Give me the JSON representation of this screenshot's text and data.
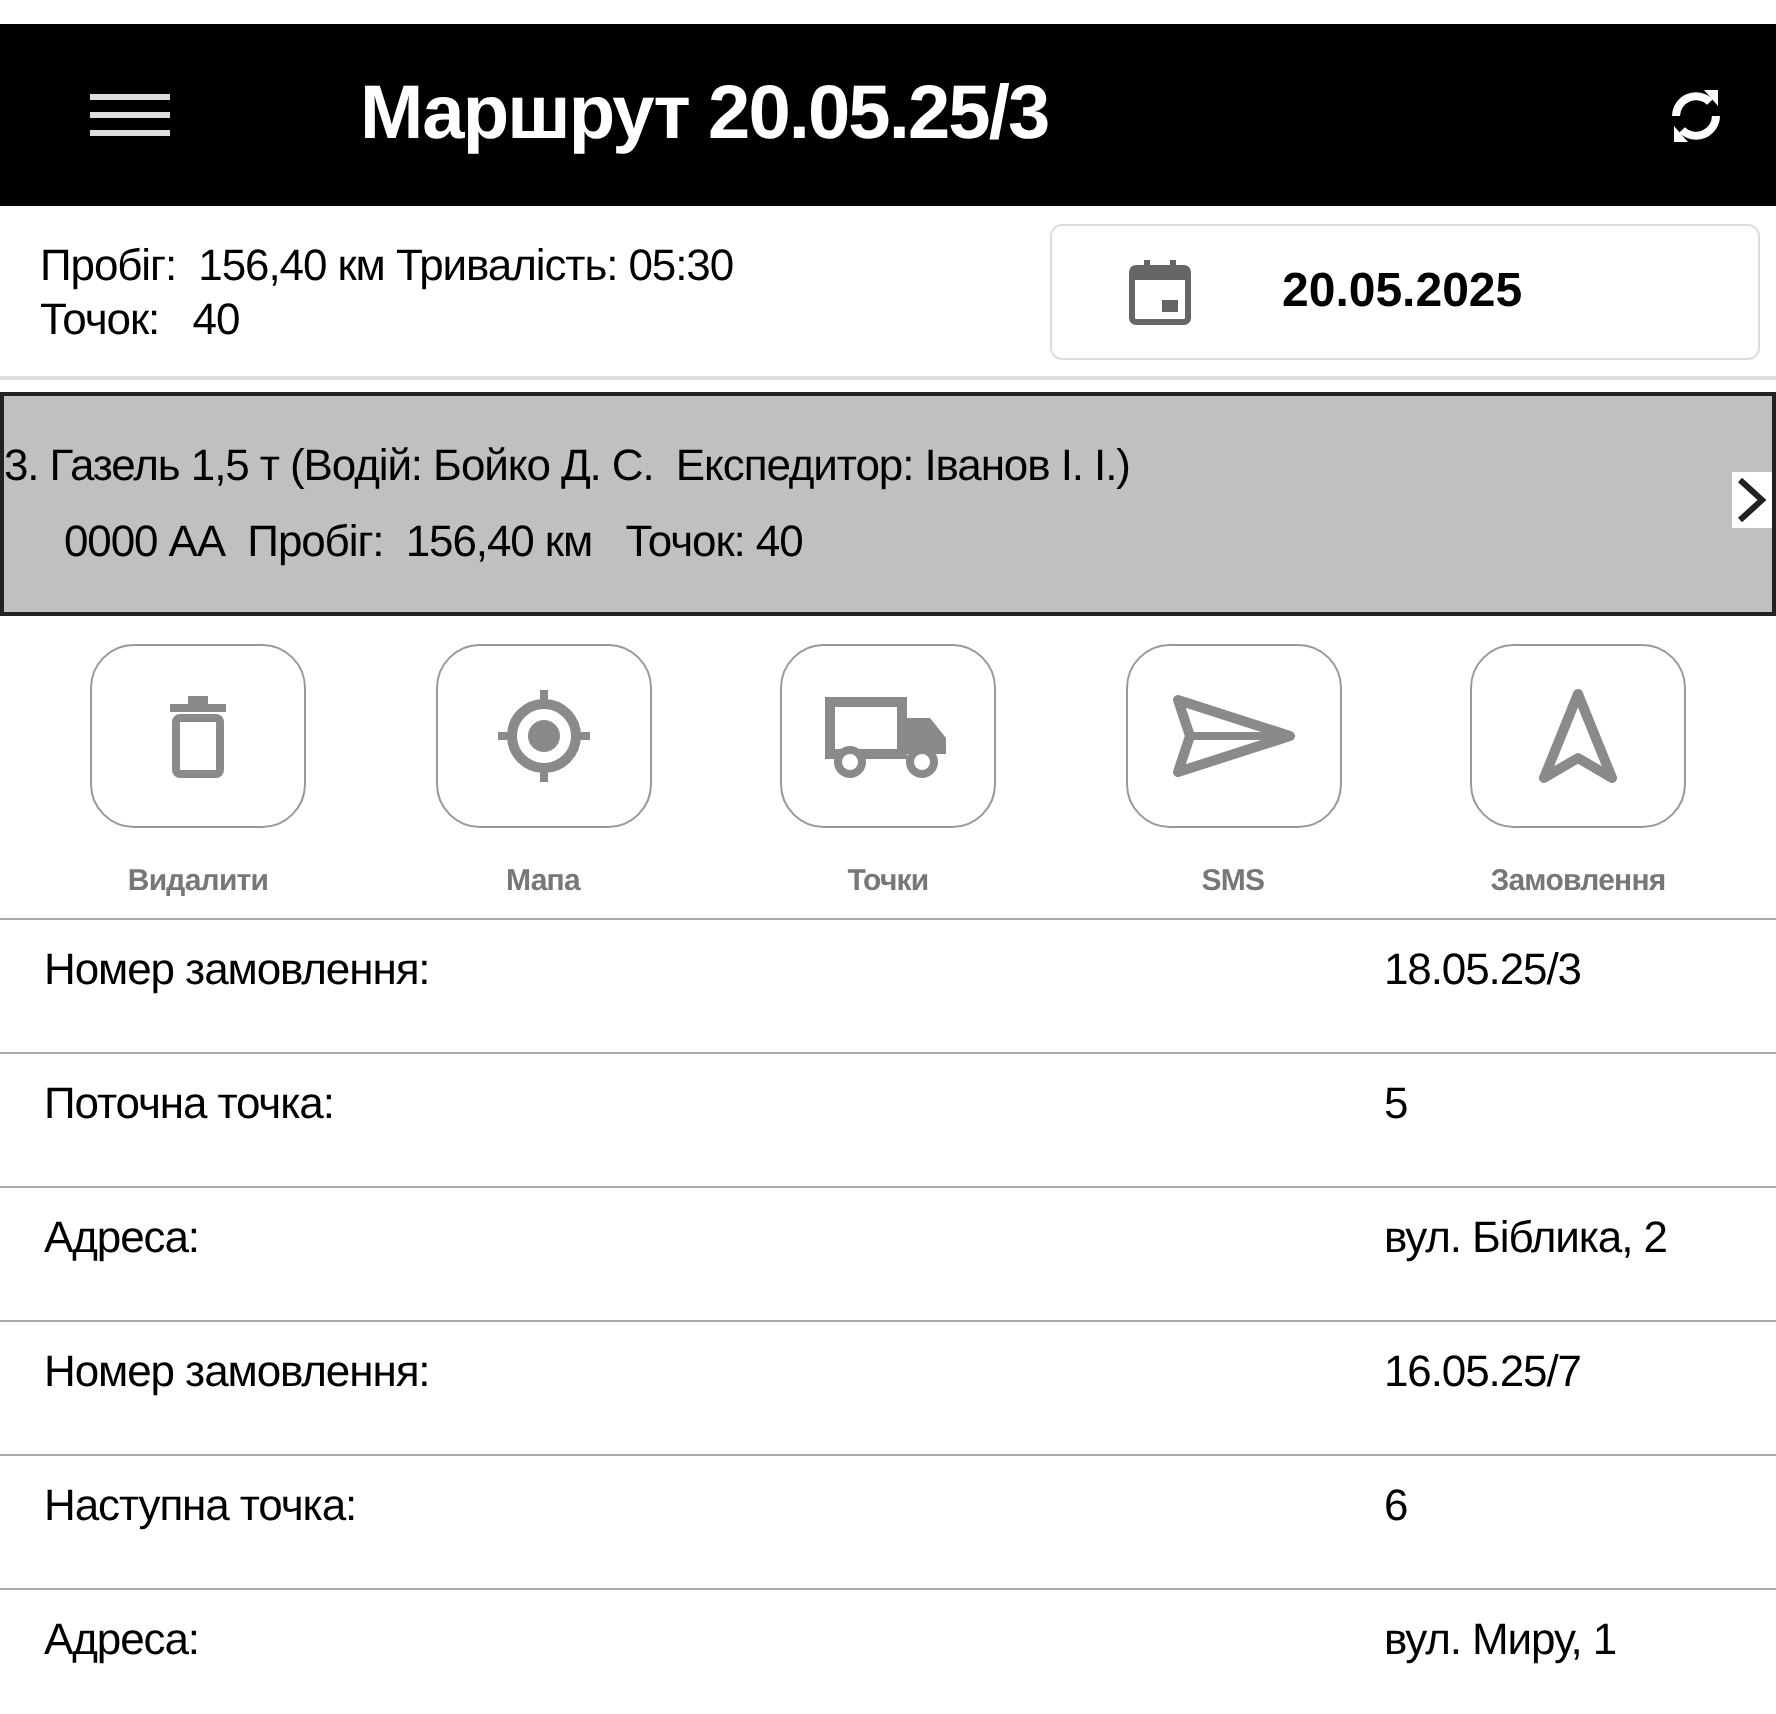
{
  "header": {
    "title": "Маршрут 20.05.25/3"
  },
  "summary": {
    "line_1": "Пробіг:  156,40 км Тривалість: 05:30",
    "line_2": "Точок:   40"
  },
  "date_button": {
    "label": "20.05.2025"
  },
  "vehicle": {
    "line_1": "3. Газель 1,5 т (Водій: Бойко Д. С.  Експедитор: Іванов І. І.)",
    "line_2": "0000 АА  Пробіг:  156,40 км   Точок: 40"
  },
  "actions": [
    {
      "kind": "delete",
      "label": "Видалити"
    },
    {
      "kind": "map",
      "label": "Мапа"
    },
    {
      "kind": "points",
      "label": "Точки"
    },
    {
      "kind": "sms",
      "label": "SMS"
    },
    {
      "kind": "orders",
      "label": "Замовлення"
    }
  ],
  "rows": [
    {
      "label": "Номер замовлення:",
      "value": "18.05.25/3"
    },
    {
      "label": "Поточна точка:",
      "value": "5"
    },
    {
      "label": "Адреса:",
      "value": "вул. Біблика, 2"
    },
    {
      "label": "Номер замовлення:",
      "value": "16.05.25/7"
    },
    {
      "label": "Наступна точка:",
      "value": "6"
    },
    {
      "label": "Адреса:",
      "value": "вул. Миру, 1"
    }
  ]
}
